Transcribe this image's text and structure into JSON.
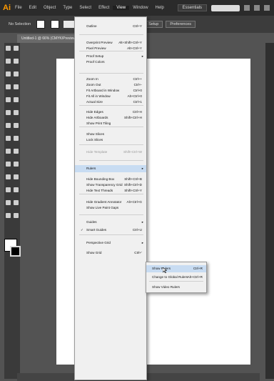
{
  "app": {
    "logo": "Ai"
  },
  "menubar": {
    "items": [
      "File",
      "Edit",
      "Object",
      "Type",
      "Select",
      "Effect",
      "View",
      "Window",
      "Help"
    ],
    "active": "View",
    "workspace": "Essentials"
  },
  "control_bar": {
    "label": "No Selection",
    "doc_setup": "Document Setup",
    "preferences": "Preferences"
  },
  "document_tab": "Untitled-1 @ 66% (CMYK/Preview)",
  "view_menu": {
    "items": [
      {
        "label": "Outline",
        "shortcut": "Ctrl+Y"
      },
      {
        "label": "Overprint Preview",
        "shortcut": "Alt+Shift+Ctrl+Y"
      },
      {
        "label": "Pixel Preview",
        "shortcut": "Alt+Ctrl+Y"
      },
      {
        "label": "Proof Setup",
        "shortcut": "",
        "submenu": true
      },
      {
        "label": "Proof Colors",
        "shortcut": ""
      },
      {
        "label": "Zoom In",
        "shortcut": "Ctrl++"
      },
      {
        "label": "Zoom Out",
        "shortcut": "Ctrl+-"
      },
      {
        "label": "Fit Artboard in Window",
        "shortcut": "Ctrl+0"
      },
      {
        "label": "Fit All in Window",
        "shortcut": "Alt+Ctrl+0"
      },
      {
        "label": "Actual Size",
        "shortcut": "Ctrl+1"
      },
      {
        "label": "Hide Edges",
        "shortcut": "Ctrl+H"
      },
      {
        "label": "Hide Artboards",
        "shortcut": "Shift+Ctrl+H"
      },
      {
        "label": "Show Print Tiling",
        "shortcut": ""
      },
      {
        "label": "Show Slices",
        "shortcut": ""
      },
      {
        "label": "Lock Slices",
        "shortcut": ""
      },
      {
        "label": "Hide Template",
        "shortcut": "Shift+Ctrl+W",
        "disabled": true
      },
      {
        "label": "Rulers",
        "shortcut": "",
        "submenu": true,
        "highlight": true
      },
      {
        "label": "Hide Bounding Box",
        "shortcut": "Shift+Ctrl+B"
      },
      {
        "label": "Show Transparency Grid",
        "shortcut": "Shift+Ctrl+D"
      },
      {
        "label": "Hide Text Threads",
        "shortcut": "Shift+Ctrl+Y"
      },
      {
        "label": "Hide Gradient Annotator",
        "shortcut": "Alt+Ctrl+G"
      },
      {
        "label": "Show Live Paint Gaps",
        "shortcut": ""
      },
      {
        "label": "Guides",
        "shortcut": "",
        "submenu": true
      },
      {
        "label": "Smart Guides",
        "shortcut": "Ctrl+U",
        "checked": true
      },
      {
        "label": "Perspective Grid",
        "shortcut": "",
        "submenu": true
      },
      {
        "label": "Show Grid",
        "shortcut": "Ctrl+'"
      }
    ]
  },
  "rulers_submenu": {
    "items": [
      {
        "label": "Show Rulers",
        "shortcut": "Ctrl+R",
        "highlight": true
      },
      {
        "label": "Change to Global Rulers",
        "shortcut": "Alt+Ctrl+R"
      },
      {
        "label": "Show Video Rulers",
        "shortcut": ""
      }
    ]
  }
}
